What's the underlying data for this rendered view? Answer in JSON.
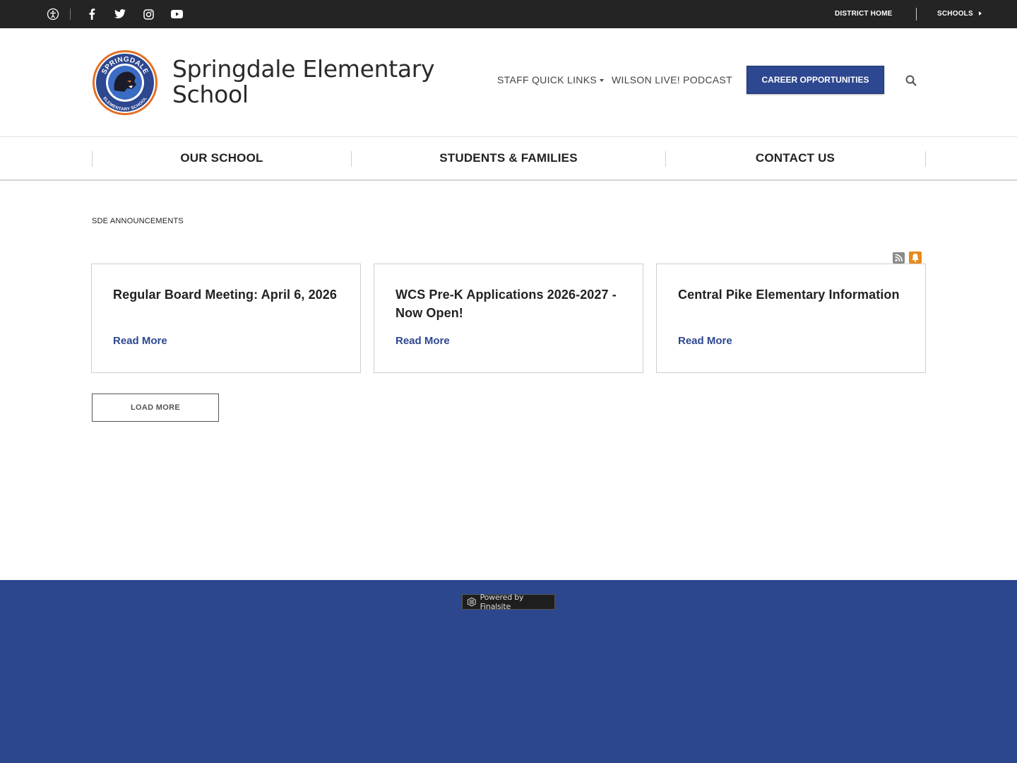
{
  "topbar": {
    "icons": [
      "accessibility-icon",
      "facebook-icon",
      "twitter-icon",
      "instagram-icon",
      "youtube-icon"
    ],
    "district_home": "DISTRICT HOME",
    "schools": "SCHOOLS"
  },
  "header": {
    "logo_top_text": "SPRINGDALE",
    "logo_bottom_text": "ELEMENTARY SCHOOL",
    "title": "Springdale Elementary School",
    "staff_quick_links": "STAFF QUICK LINKS",
    "podcast": "WILSON LIVE! PODCAST",
    "career_button": "CAREER OPPORTUNITIES",
    "search_icon": "search-icon"
  },
  "nav": {
    "items": [
      "OUR SCHOOL",
      "STUDENTS & FAMILIES",
      "CONTACT US"
    ]
  },
  "announcements": {
    "section_title": "SDE ANNOUNCEMENTS",
    "cards": [
      {
        "title": "Regular Board Meeting: April 6, 2026",
        "link": "Read More"
      },
      {
        "title": "WCS Pre-K Applications 2026-2027 - Now Open!",
        "link": "Read More"
      },
      {
        "title": "Central Pike Elementary Information",
        "link": "Read More"
      }
    ],
    "load_more": "LOAD MORE"
  },
  "footer": {
    "powered_by": "Powered by Finalsite"
  },
  "colors": {
    "topbar": "#242424",
    "brand_blue": "#2d4790",
    "footer_blue": "#2d478f",
    "bell_orange": "#e8891b",
    "rss_gray": "#8a8a8a"
  }
}
